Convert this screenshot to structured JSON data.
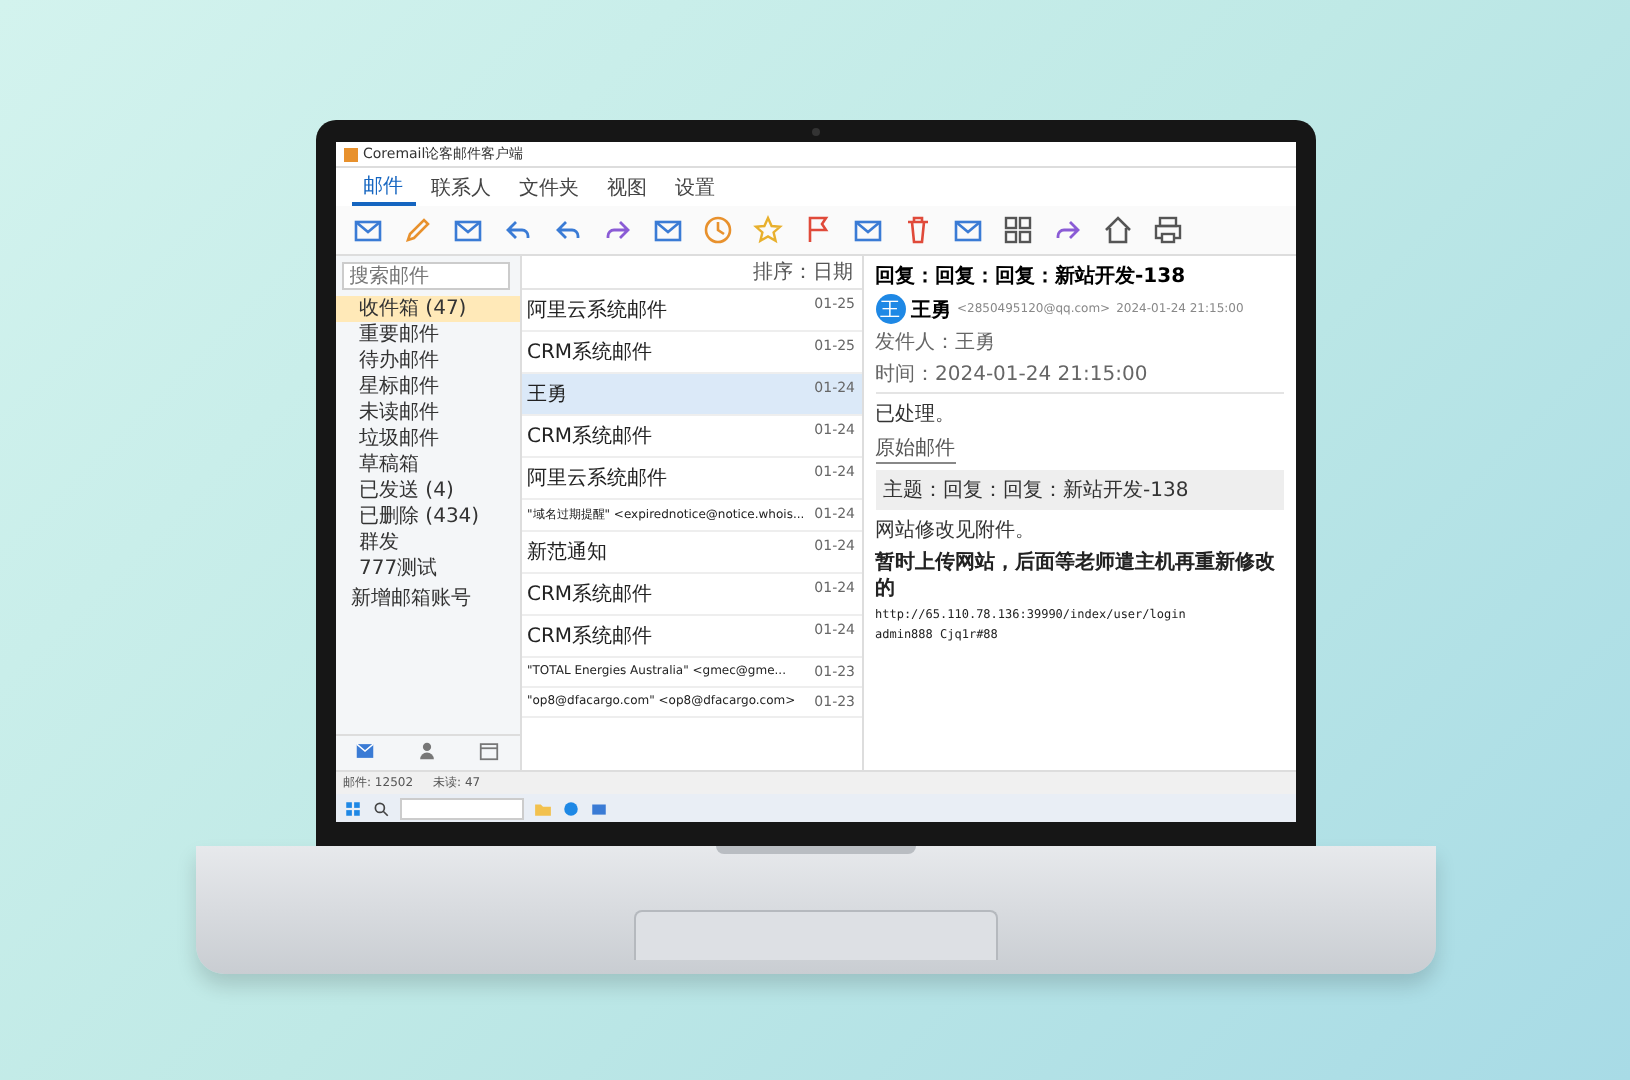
{
  "window": {
    "title": "Coremail论客邮件客户端"
  },
  "menu_tabs": [
    {
      "label": "邮件",
      "selected": true
    },
    {
      "label": "联系人",
      "selected": false
    },
    {
      "label": "文件夹",
      "selected": false
    },
    {
      "label": "视图",
      "selected": false
    },
    {
      "label": "设置",
      "selected": false
    }
  ],
  "search": {
    "placeholder": "搜索邮件"
  },
  "folders": [
    {
      "label": "收件箱 (47)",
      "selected": true
    },
    {
      "label": "重要邮件",
      "selected": false
    },
    {
      "label": "待办邮件",
      "selected": false
    },
    {
      "label": "星标邮件",
      "selected": false
    },
    {
      "label": "未读邮件",
      "selected": false
    },
    {
      "label": "垃圾邮件",
      "selected": false
    },
    {
      "label": "草稿箱",
      "selected": false
    },
    {
      "label": "已发送 (4)",
      "selected": false
    },
    {
      "label": "已删除 (434)",
      "selected": false
    },
    {
      "label": "群发",
      "selected": false
    },
    {
      "label": "777测试",
      "selected": false
    }
  ],
  "add_account": "新增邮箱账号",
  "list_sort": "排序：日期",
  "messages": [
    {
      "from": "阿里云系统邮件",
      "date": "01-25",
      "selected": false
    },
    {
      "from": "CRM系统邮件",
      "date": "01-25",
      "selected": false
    },
    {
      "from": "王勇",
      "date": "01-24",
      "selected": true
    },
    {
      "from": "CRM系统邮件",
      "date": "01-24",
      "selected": false
    },
    {
      "from": "阿里云系统邮件",
      "date": "01-24",
      "selected": false
    },
    {
      "from": "\"域名过期提醒\" <expirednotice@notice.whois...",
      "date": "01-24",
      "selected": false
    },
    {
      "from": "新范通知",
      "date": "01-24",
      "selected": false
    },
    {
      "from": "CRM系统邮件",
      "date": "01-24",
      "selected": false
    },
    {
      "from": "CRM系统邮件",
      "date": "01-24",
      "selected": false
    },
    {
      "from": "\"TOTAL Energies Australia\" <gmec@gme...",
      "date": "01-23",
      "selected": false
    },
    {
      "from": "\"op8@dfacargo.com\" <op8@dfacargo.com>",
      "date": "01-23",
      "selected": false
    }
  ],
  "reading": {
    "subject": "回复：回复：回复：新站开发-138",
    "avatar": "王",
    "sender": "王勇",
    "sender_email": "<2850495120@qq.com>",
    "date": "2024-01-24 21:15:00",
    "meta": [
      "发件人：王勇",
      "时间：2024-01-24 21:15:00"
    ],
    "body": [
      {
        "kind": "text",
        "text": "已处理。"
      },
      {
        "kind": "divider",
        "text": "原始邮件"
      },
      {
        "kind": "quote",
        "text": "主题：回复：回复：新站开发-138"
      },
      {
        "kind": "text",
        "text": "网站修改见附件。"
      },
      {
        "kind": "bold",
        "text": "暂时上传网站，后面等老师遣主机再重新修改的"
      },
      {
        "kind": "mono",
        "text": "http://65.110.78.136:39990/index/user/login"
      },
      {
        "kind": "mono",
        "text": "admin888    Cjq1r#88"
      }
    ]
  },
  "status_bar": {
    "total": "邮件: 12502",
    "unread": "未读: 47"
  }
}
